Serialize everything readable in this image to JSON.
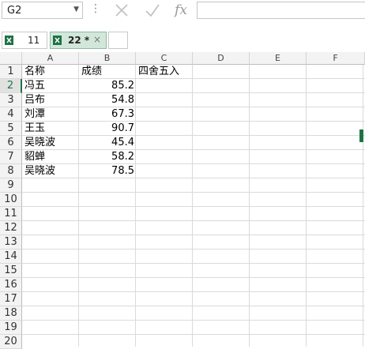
{
  "formula_bar": {
    "name_box": "G2",
    "name_box_dropdown": "▼",
    "function_label": "fx",
    "formula": ""
  },
  "tabs": [
    {
      "label": "11",
      "active": false,
      "modified": false
    },
    {
      "label": "22 *",
      "active": true,
      "modified": true,
      "close": "×"
    },
    {
      "label": "",
      "active": false
    }
  ],
  "columns": [
    "A",
    "B",
    "C",
    "D",
    "E",
    "F"
  ],
  "rows": [
    "1",
    "2",
    "3",
    "4",
    "5",
    "6",
    "7",
    "8",
    "9",
    "10",
    "11",
    "12",
    "13",
    "14",
    "15",
    "16",
    "17",
    "18",
    "19",
    "20"
  ],
  "sheet": {
    "headers": {
      "name": "名称",
      "score": "成绩",
      "rounded": "四舍五入"
    },
    "records": [
      {
        "name": "冯五",
        "score": "85.2"
      },
      {
        "name": "吕布",
        "score": "54.8"
      },
      {
        "name": "刘潭",
        "score": "67.3"
      },
      {
        "name": "王玉",
        "score": "90.7"
      },
      {
        "name": "吴晓波",
        "score": "45.4"
      },
      {
        "name": "貂蝉",
        "score": "58.2"
      },
      {
        "name": "吴晓波",
        "score": "78.5"
      }
    ]
  },
  "colors": {
    "excel_green": "#217346",
    "active_tab": "#d2e7da"
  },
  "icons": [
    "dropdown-arrow-icon",
    "cancel-x-icon",
    "enter-check-icon",
    "insert-function-icon",
    "excel-file-icon",
    "close-tab-icon"
  ]
}
